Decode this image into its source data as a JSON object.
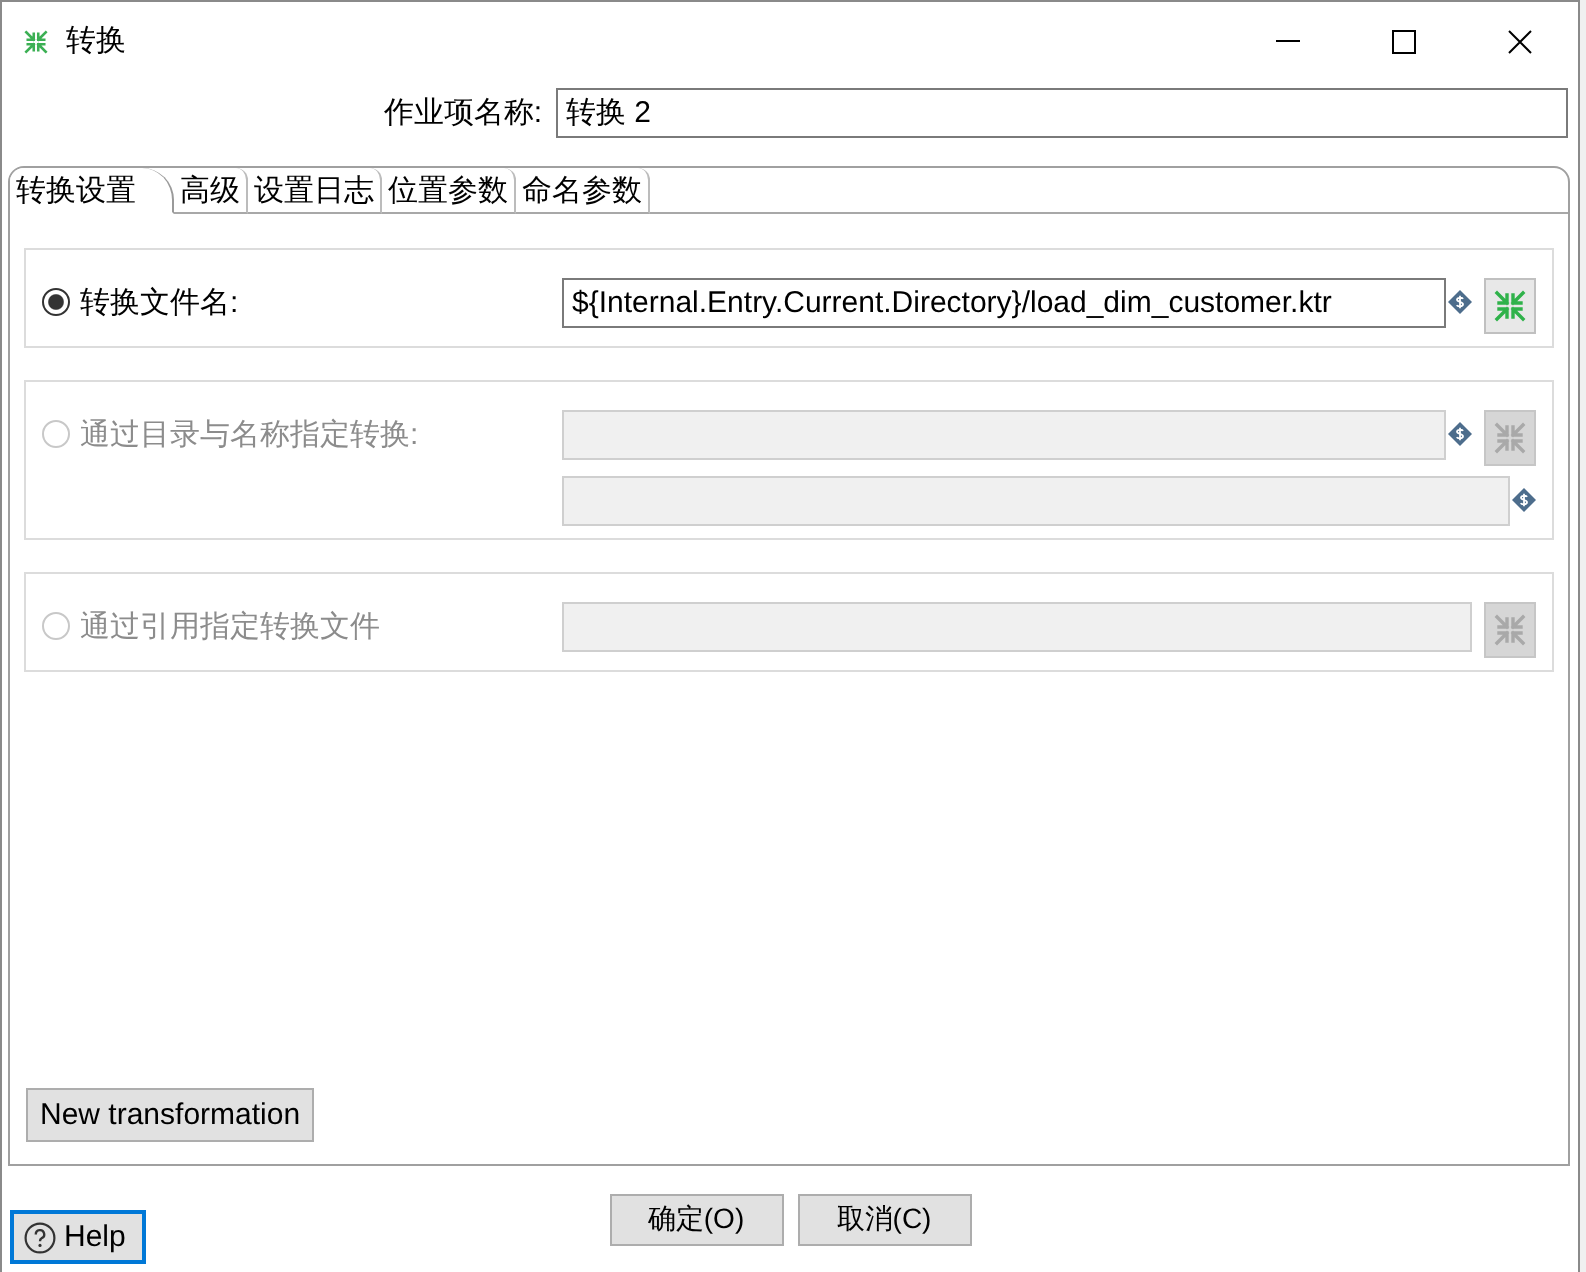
{
  "window": {
    "title": "转换"
  },
  "job_name": {
    "label": "作业项名称:",
    "value": "转换 2"
  },
  "tabs": [
    {
      "label": "转换设置",
      "selected": true
    },
    {
      "label": "高级",
      "selected": false
    },
    {
      "label": "设置日志",
      "selected": false
    },
    {
      "label": "位置参数",
      "selected": false
    },
    {
      "label": "命名参数",
      "selected": false
    }
  ],
  "options": [
    {
      "label": "转换文件名:",
      "selected": true,
      "disabled": false,
      "fields": [
        {
          "value": "${Internal.Entry.Current.Directory}/load_dim_customer.ktr",
          "variable": true,
          "browse": true
        }
      ]
    },
    {
      "label": "通过目录与名称指定转换:",
      "selected": false,
      "disabled": true,
      "fields": [
        {
          "variable": true,
          "browse": true
        },
        {
          "variable": true,
          "browse": false
        }
      ]
    },
    {
      "label": "通过引用指定转换文件",
      "selected": false,
      "disabled": true,
      "fields": [
        {
          "variable": false,
          "browse": true
        }
      ]
    }
  ],
  "new_button": "New transformation",
  "footer": {
    "help": "Help",
    "buttons": [
      "确定(O)",
      "取消(C)"
    ]
  }
}
